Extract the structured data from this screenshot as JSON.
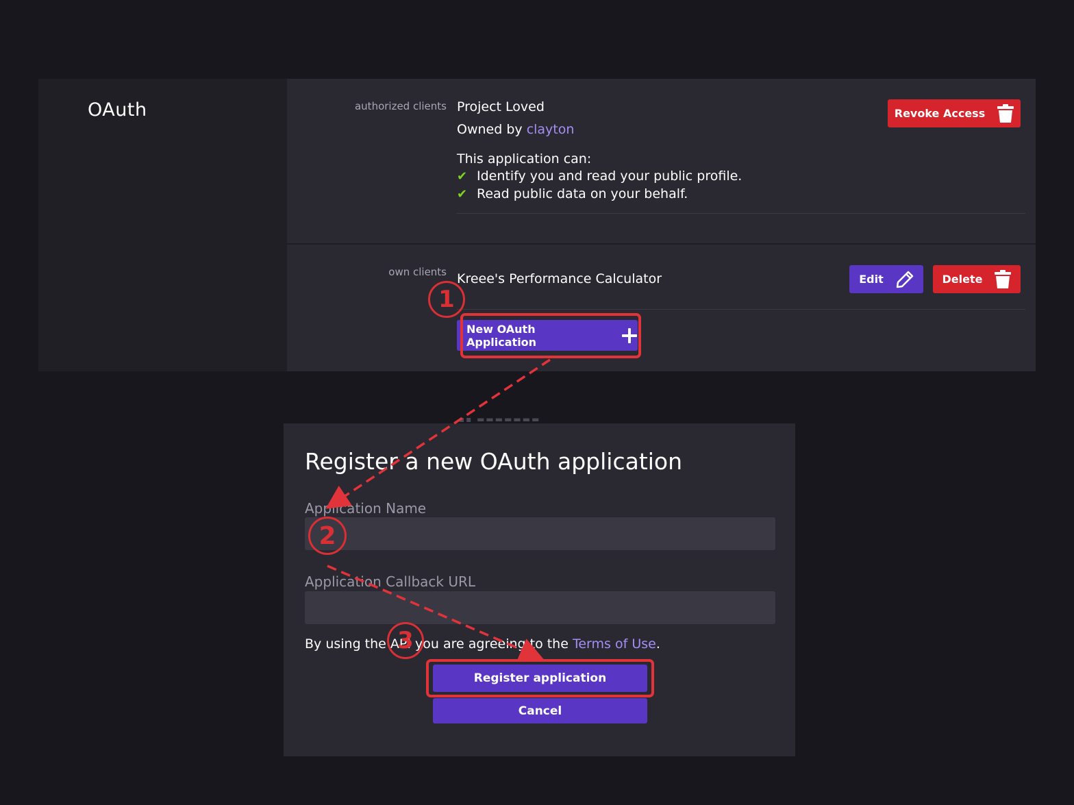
{
  "oauth_panel": {
    "heading": "OAuth",
    "authorized_section": {
      "label": "authorized clients",
      "client_name": "Project Loved",
      "owner_prefix": "Owned by",
      "owner_name": "clayton",
      "permissions_title": "This application can:",
      "permissions": [
        "Identify you and read your public profile.",
        "Read public data on your behalf."
      ],
      "revoke_label": "Revoke Access"
    },
    "own_section": {
      "label": "own clients",
      "client_name": "Kreee's Performance Calculator",
      "edit_label": "Edit",
      "delete_label": "Delete",
      "new_app_label": "New OAuth Application"
    }
  },
  "register_modal": {
    "title": "Register a new OAuth application",
    "name_label": "Application Name",
    "name_value": "",
    "callback_label": "Application Callback URL",
    "callback_value": "",
    "terms_prefix": "By using the API you are agreeing to the",
    "terms_link": "Terms of Use",
    "terms_suffix": ".",
    "register_label": "Register application",
    "cancel_label": "Cancel"
  },
  "annotations": {
    "step_1": "1",
    "step_2": "2",
    "step_3": "3",
    "highlight_color": "#e0343a"
  },
  "colors": {
    "background": "#18171d",
    "panel": "#2a2830",
    "sidebar": "#211f26",
    "danger": "#d6242c",
    "primary": "#5a36c4",
    "link": "#a58ef5",
    "check": "#7ed321"
  }
}
